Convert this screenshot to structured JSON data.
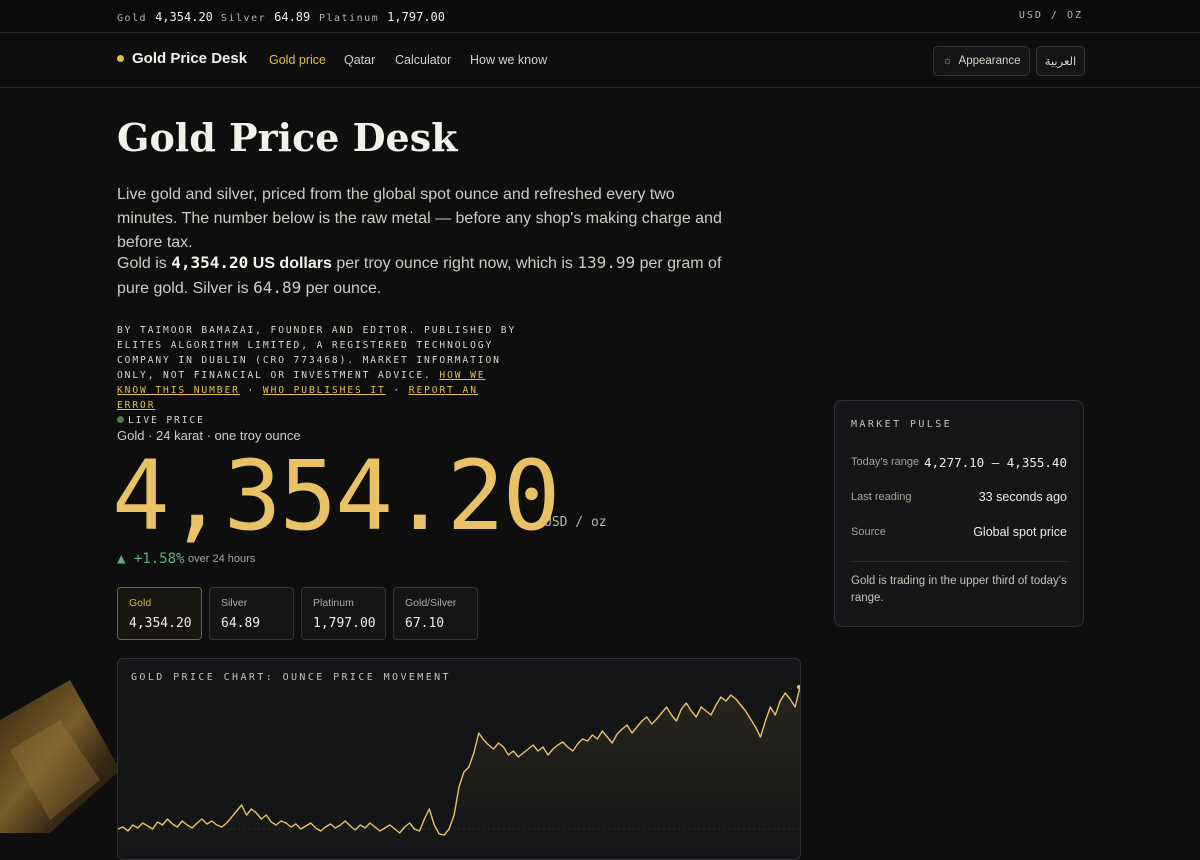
{
  "ticker": {
    "items": [
      {
        "label": "Gold",
        "value": "4,354.20"
      },
      {
        "label": "Silver",
        "value": "64.89"
      },
      {
        "label": "Platinum",
        "value": "1,797.00"
      }
    ],
    "unit": "USD / OZ"
  },
  "header": {
    "brand": "Gold Price Desk",
    "nav": [
      "Gold price",
      "Qatar",
      "Calculator",
      "How we know"
    ],
    "appearance_label": "Appearance",
    "language_label": "العربية"
  },
  "hero": {
    "title": "Gold Price Desk",
    "intro": "Live gold and silver, priced from the global spot ounce and refreshed every two minutes. The number below is the raw metal — before any shop's making charge and before tax.",
    "sentence": {
      "p1": "Gold is ",
      "gold_usd": "4,354.20",
      "unit_bold": " US dollars",
      "p2": " per troy ounce right now, which is ",
      "gram": "139.99",
      "p3": " per gram of pure gold. Silver is ",
      "silver": "64.89",
      "p4": " per ounce."
    },
    "byline": {
      "text": "By Taimoor Bamazai, founder and editor. Published by Elites Algorithm Limited, a registered technology company in Dublin (CRO 773468). Market information only, not financial or investment advice.",
      "link1": "How we know this number",
      "link2": "Who publishes it",
      "link3": "Report an error",
      "sep": "·",
      "live": "Live price"
    }
  },
  "price": {
    "caption": "Gold · 24 karat · one troy ounce",
    "value": "4,354.20",
    "unit": "USD / oz",
    "change": "▲ +1.58%",
    "change_note": "over 24 hours"
  },
  "cards": [
    {
      "label": "Gold",
      "value": "4,354.20"
    },
    {
      "label": "Silver",
      "value": "64.89"
    },
    {
      "label": "Platinum",
      "value": "1,797.00"
    },
    {
      "label": "Gold/Silver",
      "value": "67.10"
    }
  ],
  "pulse": {
    "title": "Market Pulse",
    "rows": [
      {
        "label": "Today's range",
        "value": "4,277.10 — 4,355.40"
      },
      {
        "label": "Last reading",
        "value": "33 seconds ago"
      },
      {
        "label": "Source",
        "value": "Global spot price"
      }
    ],
    "note": "Gold is trading in the upper third of today's range."
  },
  "chart": {
    "title": "Gold price chart: ounce price movement"
  },
  "chart_data": {
    "type": "area",
    "title": "Gold price chart: ounce price movement",
    "line_color": "#e8c264",
    "values": [
      8,
      10,
      6,
      12,
      9,
      14,
      11,
      8,
      15,
      12,
      18,
      13,
      10,
      16,
      12,
      9,
      14,
      18,
      13,
      16,
      12,
      10,
      14,
      20,
      26,
      32,
      22,
      28,
      24,
      18,
      22,
      15,
      12,
      16,
      14,
      10,
      13,
      8,
      11,
      14,
      9,
      6,
      10,
      13,
      9,
      12,
      16,
      11,
      7,
      12,
      9,
      14,
      10,
      6,
      9,
      12,
      8,
      4,
      10,
      14,
      8,
      6,
      18,
      28,
      12,
      3,
      2,
      8,
      22,
      50,
      65,
      70,
      84,
      104,
      97,
      92,
      88,
      94,
      90,
      82,
      86,
      80,
      84,
      88,
      92,
      86,
      90,
      82,
      88,
      92,
      95,
      90,
      86,
      93,
      98,
      96,
      102,
      98,
      106,
      100,
      94,
      103,
      108,
      112,
      104,
      110,
      116,
      120,
      113,
      118,
      124,
      130,
      122,
      116,
      128,
      134,
      126,
      120,
      130,
      126,
      122,
      132,
      140,
      136,
      142,
      138,
      132,
      126,
      118,
      110,
      100,
      116,
      130,
      122,
      136,
      144,
      138,
      130,
      150
    ]
  }
}
